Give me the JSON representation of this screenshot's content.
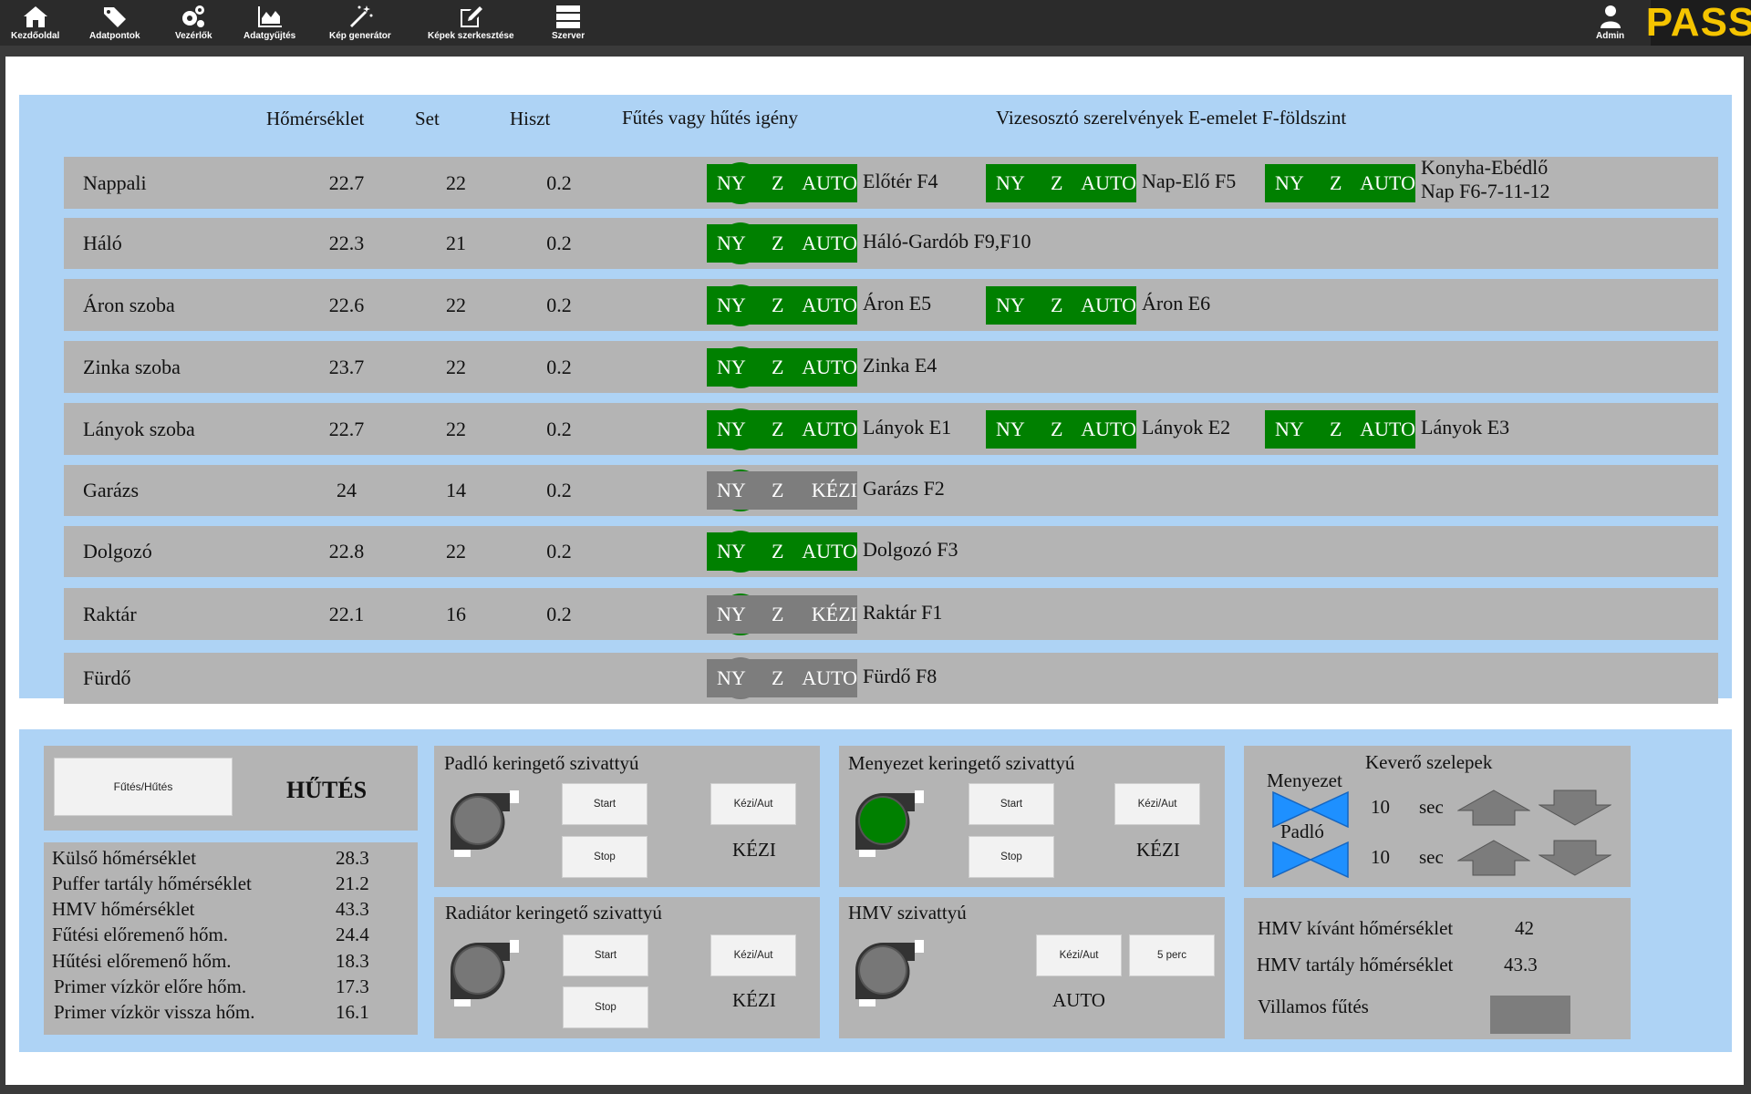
{
  "nav": [
    {
      "label": "Kezdőoldal",
      "icon": "home-icon"
    },
    {
      "label": "Adatpontok",
      "icon": "tags-icon"
    },
    {
      "label": "Vezérlők",
      "icon": "gears-icon"
    },
    {
      "label": "Adatgyűjtés",
      "icon": "area-chart-icon"
    },
    {
      "label": "Kép generátor",
      "icon": "magic-wand-icon"
    },
    {
      "label": "Képek szerkesztése",
      "icon": "edit-icon"
    },
    {
      "label": "Szerver",
      "icon": "server-icon"
    }
  ],
  "user": {
    "label": "Admin",
    "icon": "user-icon"
  },
  "logo": "PASS",
  "table": {
    "headers": {
      "temp": "Hőmérséklet",
      "set": "Set",
      "hyst": "Hiszt",
      "demand": "Fűtés vagy hűtés igény",
      "valves": "Vizesosztó szerelvények  E-emelet F-földszint"
    },
    "rows": [
      {
        "name": "Nappali",
        "temp": "22.7",
        "set": "22",
        "hyst": "0.2",
        "demand": "#008000",
        "valves": [
          {
            "ny": "NY",
            "z": "Z",
            "mode": "AUTO",
            "active": true,
            "label": "Előtér F4"
          },
          {
            "ny": "NY",
            "z": "Z",
            "mode": "AUTO",
            "active": true,
            "label": "Nap-Elő F5"
          },
          {
            "ny": "NY",
            "z": "Z",
            "mode": "AUTO",
            "active": true,
            "label": "Konyha-Ebédlő",
            "label2": "Nap F6-7-11-12"
          }
        ]
      },
      {
        "name": "Háló",
        "temp": "22.3",
        "set": "21",
        "hyst": "0.2",
        "demand": "#008000",
        "valves": [
          {
            "ny": "NY",
            "z": "Z",
            "mode": "AUTO",
            "active": true,
            "label": "Háló-Gardób F9,F10"
          }
        ]
      },
      {
        "name": "Áron szoba",
        "temp": "22.6",
        "set": "22",
        "hyst": "0.2",
        "demand": "#008000",
        "valves": [
          {
            "ny": "NY",
            "z": "Z",
            "mode": "AUTO",
            "active": true,
            "label": "Áron E5"
          },
          {
            "ny": "NY",
            "z": "Z",
            "mode": "AUTO",
            "active": true,
            "label": "Áron E6"
          }
        ]
      },
      {
        "name": "Zinka szoba",
        "temp": "23.7",
        "set": "22",
        "hyst": "0.2",
        "demand": "#008000",
        "valves": [
          {
            "ny": "NY",
            "z": "Z",
            "mode": "AUTO",
            "active": true,
            "label": "Zinka E4"
          }
        ]
      },
      {
        "name": "Lányok szoba",
        "temp": "22.7",
        "set": "22",
        "hyst": "0.2",
        "demand": "#008000",
        "valves": [
          {
            "ny": "NY",
            "z": "Z",
            "mode": "AUTO",
            "active": true,
            "label": "Lányok E1"
          },
          {
            "ny": "NY",
            "z": "Z",
            "mode": "AUTO",
            "active": true,
            "label": "Lányok E2"
          },
          {
            "ny": "NY",
            "z": "Z",
            "mode": "AUTO",
            "active": true,
            "label": "Lányok E3"
          }
        ]
      },
      {
        "name": "Garázs",
        "temp": "24",
        "set": "14",
        "hyst": "0.2",
        "demand": "#008000",
        "valves": [
          {
            "ny": "NY",
            "z": "Z",
            "mode": "KÉZI",
            "active": false,
            "label": "Garázs F2"
          }
        ]
      },
      {
        "name": "Dolgozó",
        "temp": "22.8",
        "set": "22",
        "hyst": "0.2",
        "demand": "#008000",
        "valves": [
          {
            "ny": "NY",
            "z": "Z",
            "mode": "AUTO",
            "active": true,
            "label": "Dolgozó F3"
          }
        ]
      },
      {
        "name": "Raktár",
        "temp": "22.1",
        "set": "16",
        "hyst": "0.2",
        "demand": "#008000",
        "valves": [
          {
            "ny": "NY",
            "z": "Z",
            "mode": "KÉZI",
            "active": false,
            "label": "Raktár F1"
          }
        ]
      },
      {
        "name": "Fürdő",
        "temp": "",
        "set": "",
        "hyst": "",
        "demand": "#7a7a7a",
        "valves": [
          {
            "ny": "NY",
            "z": "Z",
            "mode": "AUTO",
            "active": false,
            "label": "Fürdő F8"
          }
        ]
      }
    ]
  },
  "mode": {
    "button": "Fűtés/Hűtés",
    "value": "HŰTÉS"
  },
  "sensors": [
    {
      "label": "Külső hőmérséklet",
      "value": "28.3"
    },
    {
      "label": "Puffer tartály hőmérséklet",
      "value": "21.2"
    },
    {
      "label": "HMV hőmérséklet",
      "value": "43.3"
    },
    {
      "label": "Fűtési előremenő hőm.",
      "value": "24.4"
    },
    {
      "label": "Hűtési előremenő hőm.",
      "value": "18.3"
    },
    {
      "label": "Primer vízkör előre hőm.",
      "value": "17.3"
    },
    {
      "label": "Primer vízkör vissza hőm.",
      "value": "16.1"
    }
  ],
  "pumps": {
    "floor": {
      "title": "Padló keringető szivattyú",
      "start": "Start",
      "stop": "Stop",
      "toggle": "Kézi/Aut",
      "status": "KÉZI",
      "running": false
    },
    "ceiling": {
      "title": "Menyezet keringető szivattyú",
      "start": "Start",
      "stop": "Stop",
      "toggle": "Kézi/Aut",
      "status": "KÉZI",
      "running": true
    },
    "radiator": {
      "title": "Radiátor keringető szivattyú",
      "start": "Start",
      "stop": "Stop",
      "toggle": "Kézi/Aut",
      "status": "KÉZI",
      "running": false
    },
    "hmv": {
      "title": "HMV szivattyú",
      "toggle": "Kézi/Aut",
      "timer": "5 perc",
      "status": "AUTO",
      "running": false
    }
  },
  "mixing": {
    "title": "Keverő szelepek",
    "ceiling": {
      "label": "Menyezet",
      "value": "10",
      "unit": "sec"
    },
    "floor": {
      "label": "Padló",
      "value": "10",
      "unit": "sec"
    }
  },
  "hmv": {
    "target_label": "HMV kívánt hőmérséklet",
    "target_value": "42",
    "tank_label": "HMV tartály hőmérséklet",
    "tank_value": "43.3",
    "electric_label": "Villamos fűtés"
  },
  "colors": {
    "active_green": "#008000",
    "inactive_grey": "#7d7d7d",
    "panel_blue": "#aed3f5",
    "valve_blue": "#1e90ff",
    "logo_yellow": "#f5c400"
  }
}
